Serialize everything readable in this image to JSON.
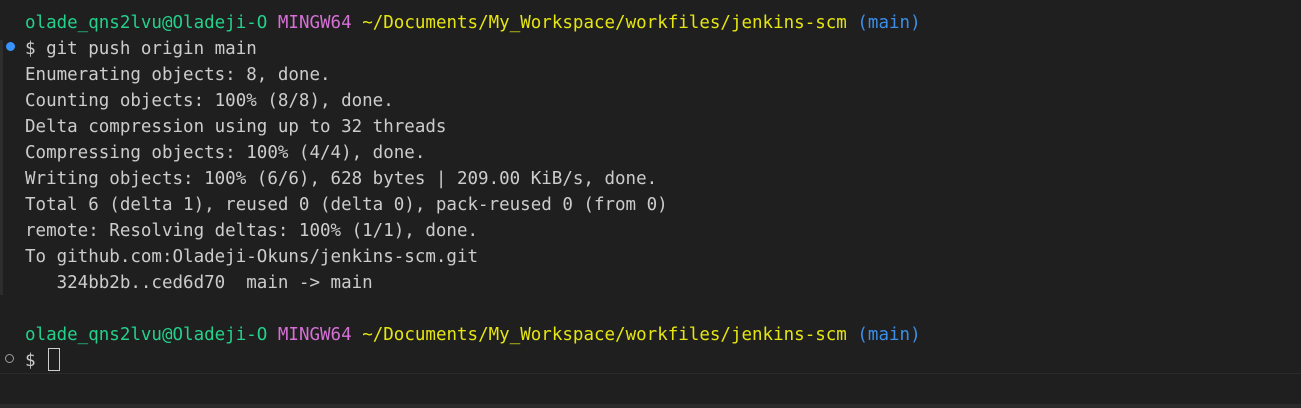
{
  "prompt1": {
    "user_host": "olade_qns2lvu@Oladeji-O",
    "msystem": "MINGW64",
    "path": "~/Documents/My_Workspace/workfiles/jenkins-scm",
    "branch": "(main)"
  },
  "command": "$ git push origin main",
  "output": [
    "Enumerating objects: 8, done.",
    "Counting objects: 100% (8/8), done.",
    "Delta compression using up to 32 threads",
    "Compressing objects: 100% (4/4), done.",
    "Writing objects: 100% (6/6), 628 bytes | 209.00 KiB/s, done.",
    "Total 6 (delta 1), reused 0 (delta 0), pack-reused 0 (from 0)",
    "remote: Resolving deltas: 100% (1/1), done.",
    "To github.com:Oladeji-Okuns/jenkins-scm.git",
    "   324bb2b..ced6d70  main -> main"
  ],
  "prompt2": {
    "user_host": "olade_qns2lvu@Oladeji-O",
    "msystem": "MINGW64",
    "path": "~/Documents/My_Workspace/workfiles/jenkins-scm",
    "branch": "(main)"
  },
  "input_prompt": "$ ",
  "colors": {
    "background": "#1f1f1f",
    "foreground": "#cccccc",
    "user_host": "#23d18b",
    "msystem": "#d670d6",
    "path": "#e5e510",
    "branch": "#3b8eea",
    "decoration_success": "#3794ff"
  },
  "icons": {
    "completed_command_decoration": "filled-circle",
    "pending_command_decoration": "hollow-circle"
  }
}
